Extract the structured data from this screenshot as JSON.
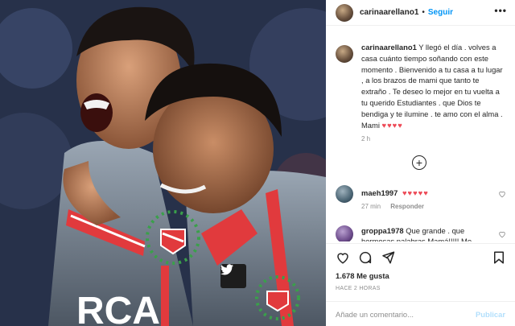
{
  "header": {
    "username": "carinaarellano1",
    "separator": "•",
    "follow_label": "Seguir",
    "more_icon": "more-horizontal-icon"
  },
  "caption": {
    "username": "carinaarellano1",
    "text": "Y llegó el día . volves a casa cuánto tiempo soñando con este momento . Bienvenido a tu casa a tu lugar , a los brazos de mami que tanto te extraño . Te deseo lo mejor en tu vuelta a tu querido Estudiantes . que Dios te bendiga y te ilumine . te amo con el alma . Mami",
    "hearts": "♥♥♥♥",
    "time": "2 h"
  },
  "load_more_label": "+",
  "comments": [
    {
      "username": "maeh1997",
      "text": "♥♥♥♥♥",
      "time": "27 min",
      "reply_label": "Responder",
      "like_icon": "heart-outline-icon"
    },
    {
      "username": "groppa1978",
      "text": "Que grande . que hermosas palabras Mamá!!!!! Me",
      "like_icon": "heart-outline-icon"
    }
  ],
  "actions": {
    "like_icon": "heart-outline-icon",
    "comment_icon": "comment-icon",
    "share_icon": "send-icon",
    "save_icon": "bookmark-icon",
    "likes_text": "1.678 Me gusta",
    "posted_ago": "HACE 2 HORAS"
  },
  "add_comment": {
    "placeholder": "Añade un comentario...",
    "publish_label": "Publicar"
  },
  "photo": {
    "jersey_text": "RCA",
    "watermark_icon": "twitter-icon"
  },
  "colors": {
    "accent": "#0095f6",
    "heart": "#ed4956",
    "publish_disabled": "#b2dffc",
    "muted": "#8e8e8e"
  }
}
